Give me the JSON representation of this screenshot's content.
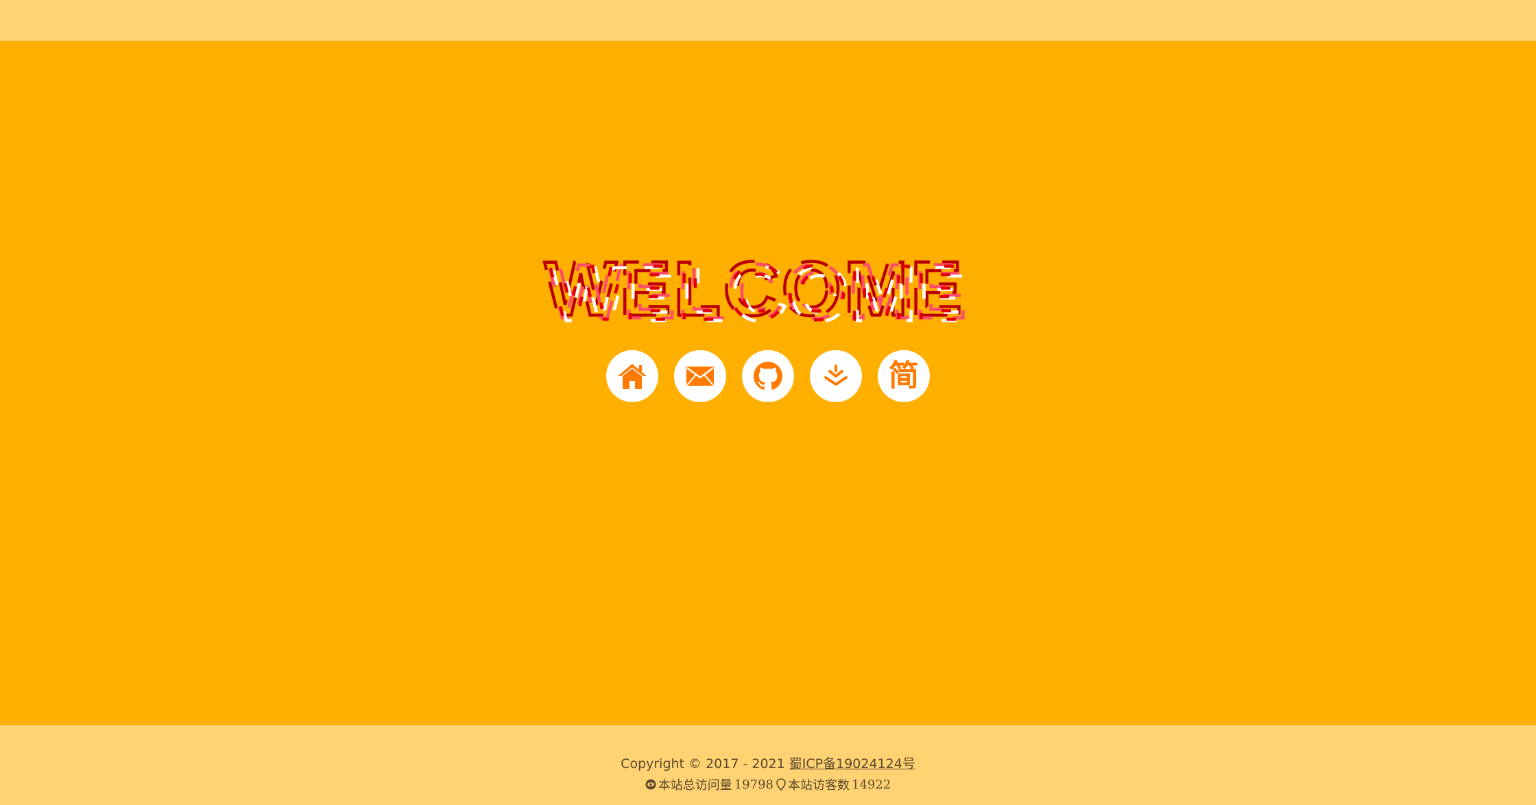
{
  "hero": {
    "title": "WELCOME",
    "title_stroke_colors": [
      "#d40000",
      "#ff3c5a",
      "#ffffff",
      "#b80000"
    ]
  },
  "links": [
    {
      "icon": "home-icon",
      "label": "home"
    },
    {
      "icon": "mail-icon",
      "label": "email"
    },
    {
      "icon": "github-icon",
      "label": "github"
    },
    {
      "icon": "yuque-icon",
      "label": "yuque"
    },
    {
      "icon": "jianshu-icon",
      "label": "简"
    }
  ],
  "footer": {
    "copyright": "Copyright © 2017 - 2021 ",
    "icp": "蜀ICP备19024124号",
    "pv_label": "本站总访问量 ",
    "pv_value": "19798",
    "uv_label": "本站访客数 ",
    "uv_value": "14922"
  },
  "colors": {
    "page_bg": "#ffaf00",
    "bars_bg": "#ffd374",
    "icon_color": "#ff7a00",
    "footer_text": "#5d4a2d"
  }
}
